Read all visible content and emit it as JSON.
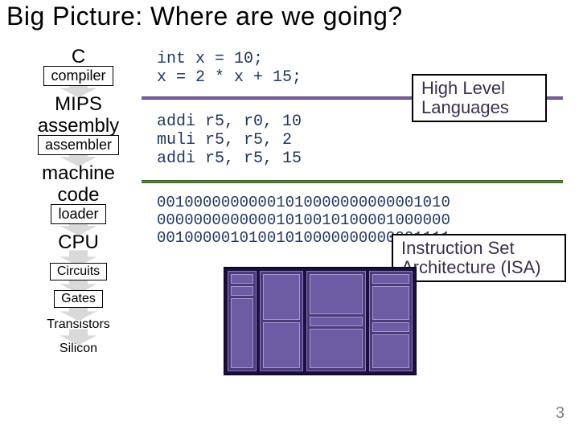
{
  "title": "Big Picture: Where are we going?",
  "stages": {
    "c": "C",
    "compiler": "compiler",
    "mips": "MIPS\nassembly",
    "assembler": "assembler",
    "machine": "machine\ncode",
    "loader": "loader",
    "cpu": "CPU",
    "circuits": "Circuits",
    "gates": "Gates",
    "transistors": "Transistors",
    "silicon": "Silicon"
  },
  "code": {
    "c": "int x = 10;\nx = 2 * x + 15;",
    "asm": "addi r5, r0, 10\nmuli r5, r5, 2\naddi r5, r5, 15",
    "bin": "00100000000001010000000000001010\n00000000000001010010100001000000\n00100000101001010000000000001111"
  },
  "boxes": {
    "hll": "High Level\nLanguages",
    "isa": "Instruction Set\nArchitecture (ISA)"
  },
  "page": "3"
}
